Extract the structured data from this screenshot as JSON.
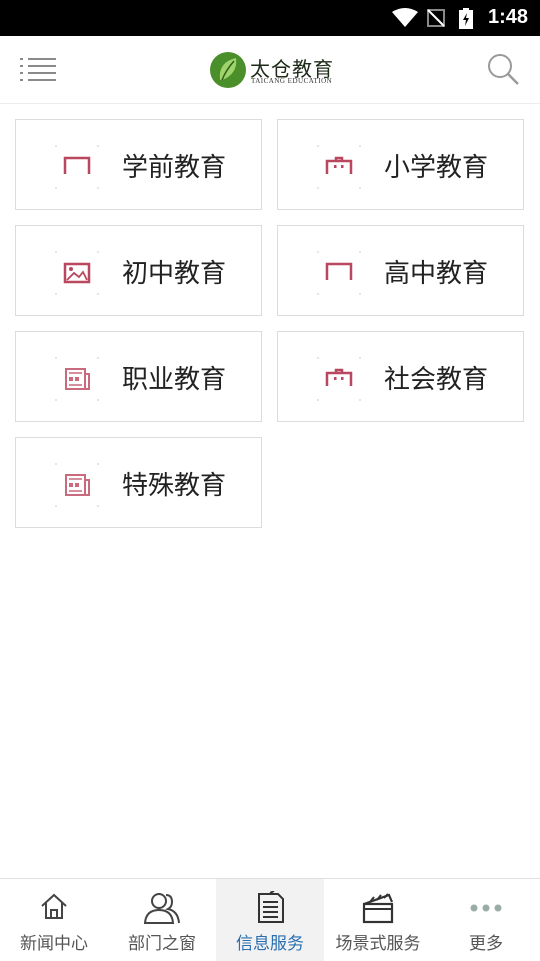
{
  "status_bar": {
    "time": "1:48"
  },
  "header": {
    "logo_title": "太仓教育",
    "logo_subtitle": "TAICANG EDUCATION",
    "menu_icon": "list-menu-icon",
    "search_icon": "search-icon"
  },
  "categories": [
    {
      "label": "学前教育",
      "icon": "building-icon"
    },
    {
      "label": "小学教育",
      "icon": "school-icon"
    },
    {
      "label": "初中教育",
      "icon": "picture-icon"
    },
    {
      "label": "高中教育",
      "icon": "building-icon"
    },
    {
      "label": "职业教育",
      "icon": "newspaper-icon"
    },
    {
      "label": "社会教育",
      "icon": "school-icon"
    },
    {
      "label": "特殊教育",
      "icon": "newspaper-icon"
    }
  ],
  "tabs": [
    {
      "label": "新闻中心",
      "icon": "home-icon",
      "active": false
    },
    {
      "label": "部门之窗",
      "icon": "people-icon",
      "active": false
    },
    {
      "label": "信息服务",
      "icon": "document-icon",
      "active": true
    },
    {
      "label": "场景式服务",
      "icon": "clapperboard-icon",
      "active": false
    },
    {
      "label": "更多",
      "icon": "more-dots-icon",
      "active": false
    }
  ],
  "colors": {
    "accent": "#b8475f",
    "active_tab_text": "#2a6fb0",
    "logo_green": "#4a8f2a"
  }
}
